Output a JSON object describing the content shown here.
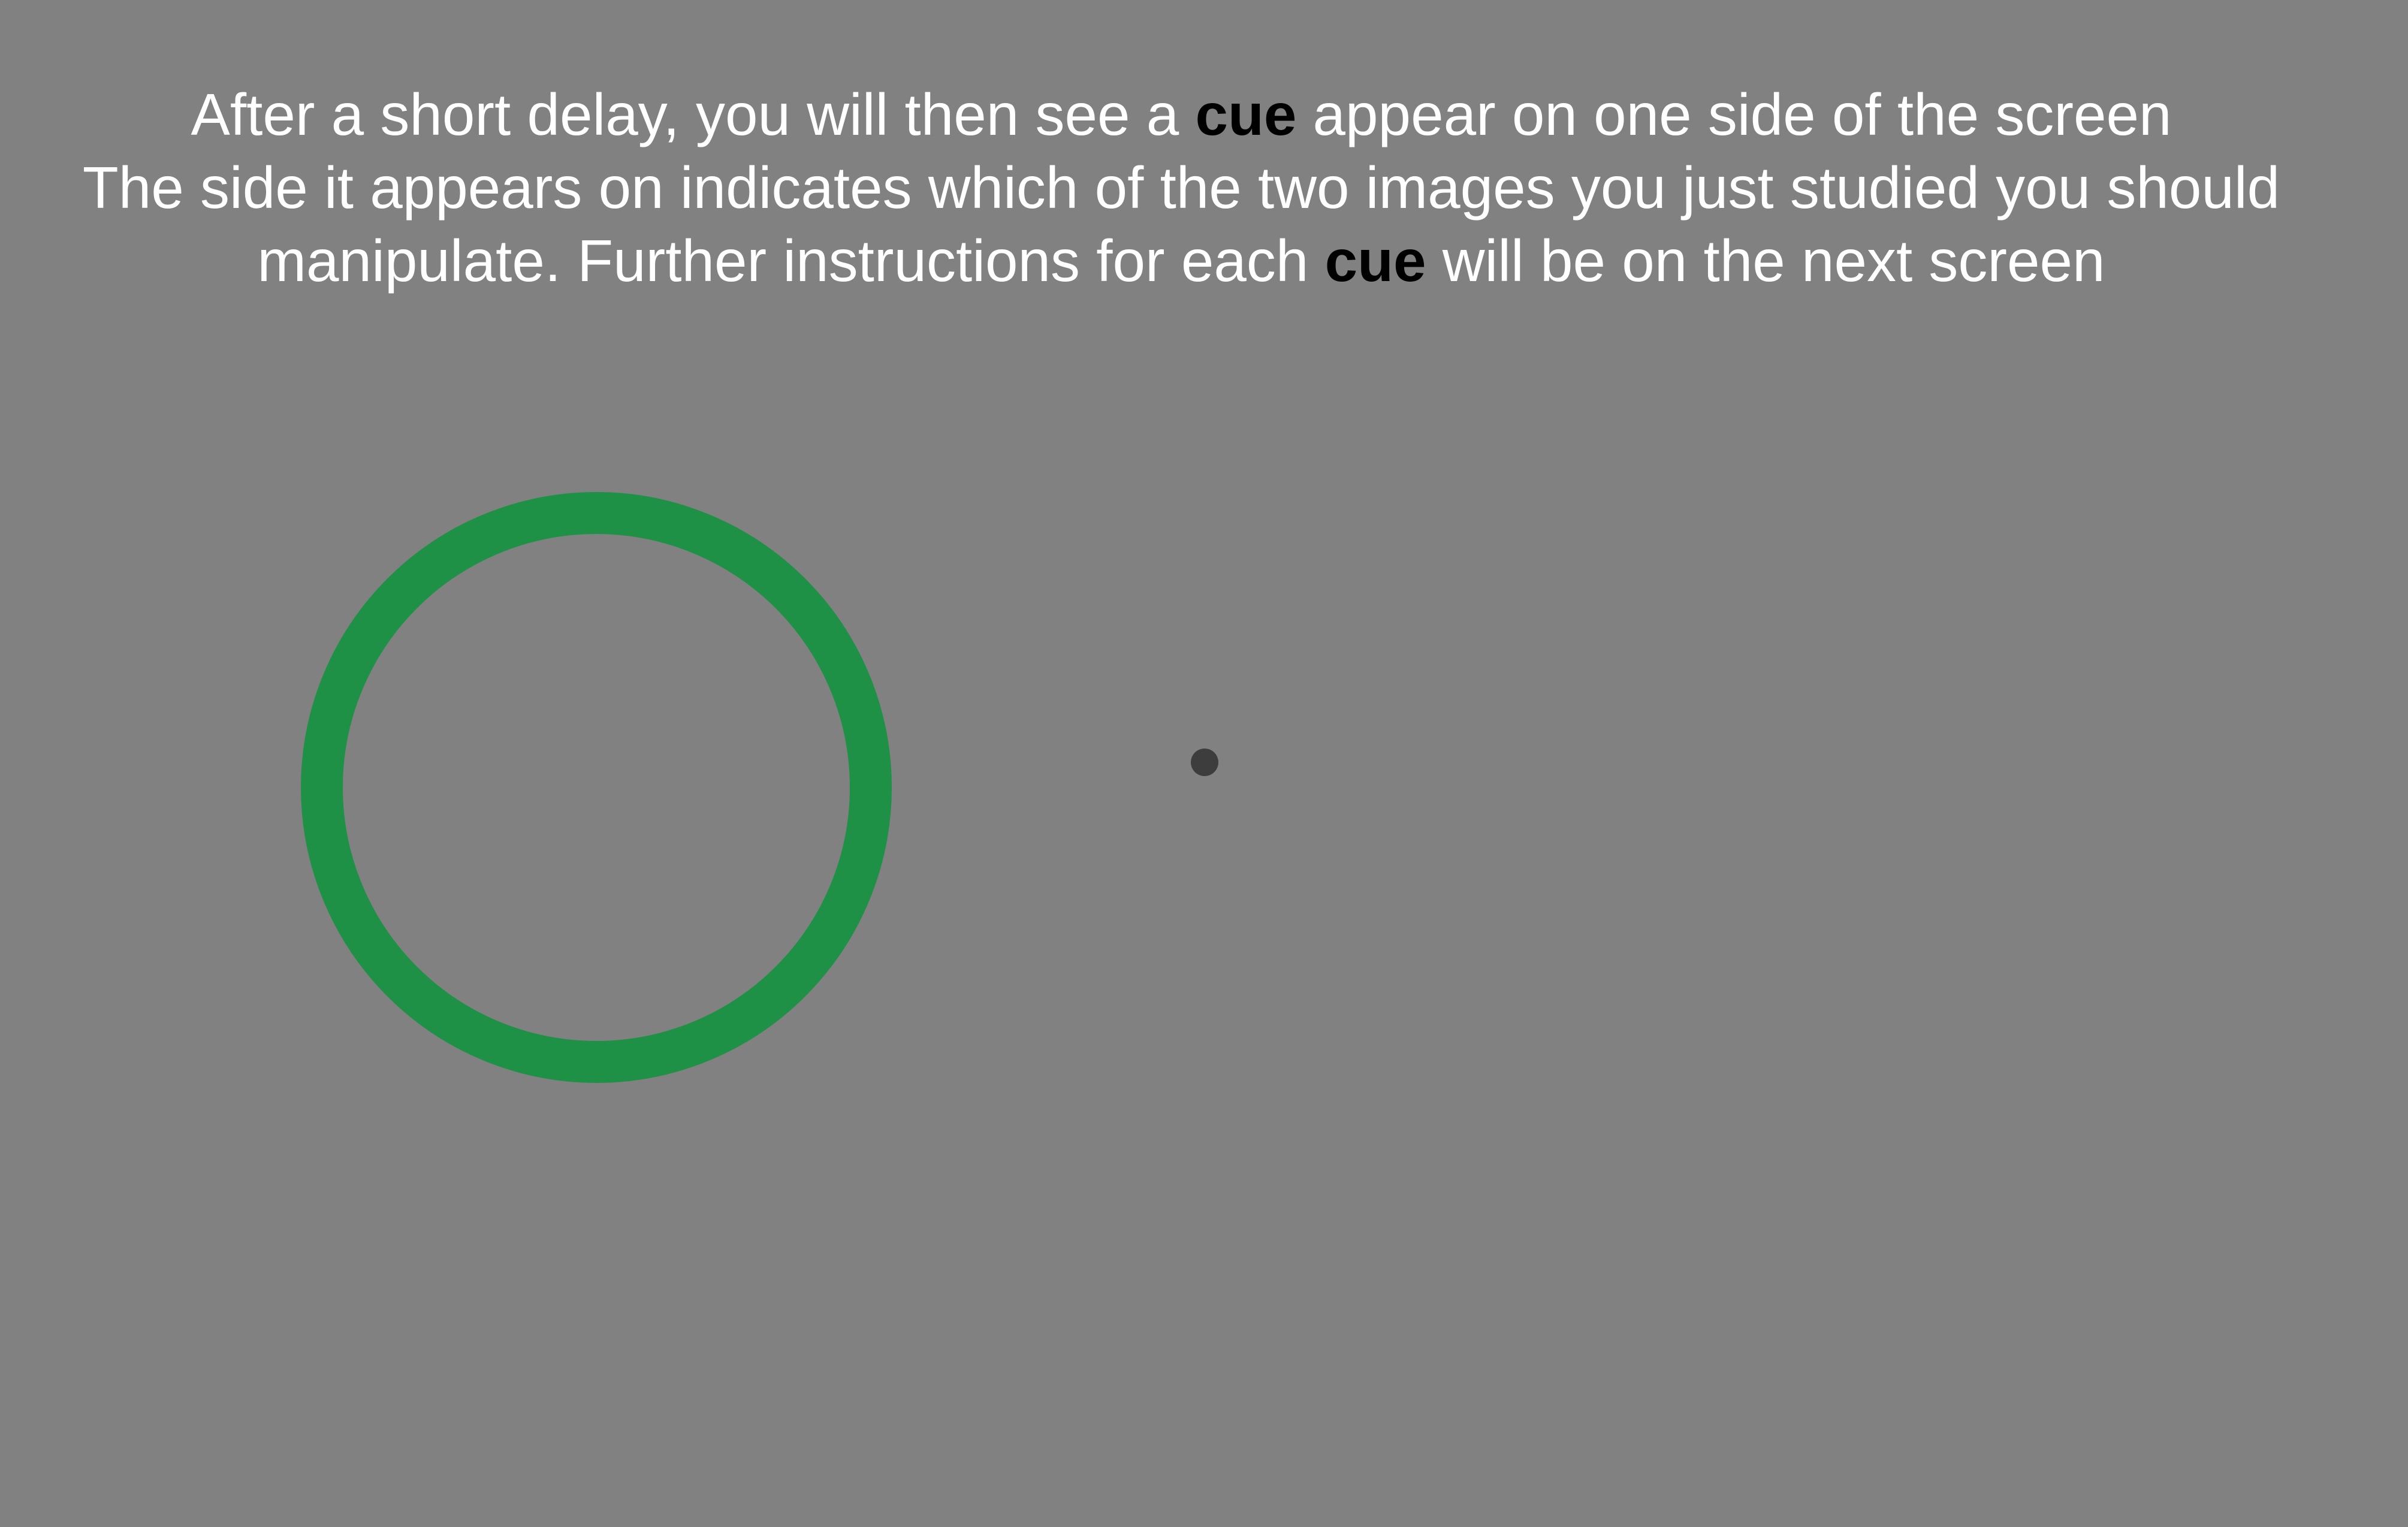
{
  "instructions": {
    "line1": {
      "before": "After a short delay, you will then see a ",
      "emphasis": "cue",
      "after": " appear on one side of the screen"
    },
    "line2": {
      "text": "The side it appears on indicates which of the two images you just studied you should"
    },
    "line3": {
      "before": "manipulate. Further instructions for each ",
      "emphasis": "cue",
      "after": " will be on the next screen"
    }
  },
  "stimulus": {
    "cue_color": "#1f9146",
    "cue_side": "left",
    "fixation_color": "#3d3d3d",
    "background_color": "#808180"
  }
}
